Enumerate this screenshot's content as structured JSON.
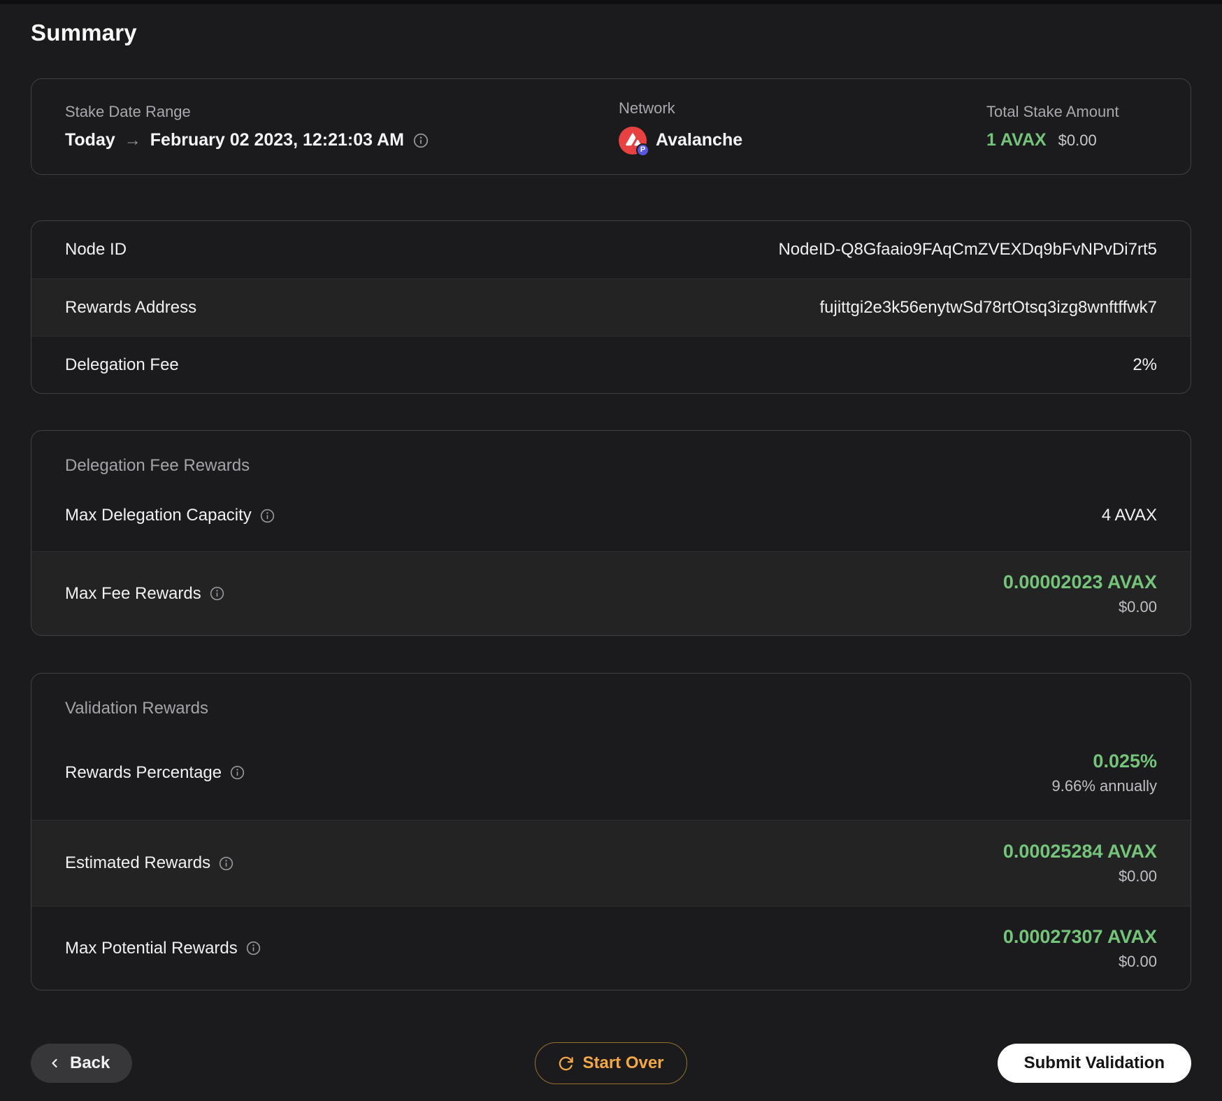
{
  "title": "Summary",
  "overview": {
    "date_range": {
      "label": "Stake Date Range",
      "from": "Today",
      "arrow": "→",
      "to": "February 02 2023, 12:21:03 AM"
    },
    "network": {
      "label": "Network",
      "name": "Avalanche",
      "badge": "P"
    },
    "total_stake": {
      "label": "Total Stake Amount",
      "amount": "1 AVAX",
      "usd": "$0.00"
    }
  },
  "node_details": {
    "rows": [
      {
        "label": "Node ID",
        "value": "NodeID-Q8Gfaaio9FAqCmZVEXDq9bFvNPvDi7rt5"
      },
      {
        "label": "Rewards Address",
        "value": "fujittgi2e3k56enytwSd78rtOtsq3izg8wnftffwk7"
      },
      {
        "label": "Delegation Fee",
        "value": "2%"
      }
    ]
  },
  "delegation_fee_rewards": {
    "title": "Delegation Fee Rewards",
    "max_delegation_capacity": {
      "label": "Max Delegation Capacity",
      "value": "4 AVAX"
    },
    "max_fee_rewards": {
      "label": "Max Fee Rewards",
      "value": "0.00002023 AVAX",
      "usd": "$0.00"
    }
  },
  "validation_rewards": {
    "title": "Validation Rewards",
    "rewards_percentage": {
      "label": "Rewards Percentage",
      "value": "0.025%",
      "sub": "9.66% annually"
    },
    "estimated_rewards": {
      "label": "Estimated Rewards",
      "value": "0.00025284 AVAX",
      "usd": "$0.00"
    },
    "max_potential_rewards": {
      "label": "Max Potential Rewards",
      "value": "0.00027307 AVAX",
      "usd": "$0.00"
    }
  },
  "footer": {
    "back": "Back",
    "start_over": "Start Over",
    "submit": "Submit Validation"
  },
  "colors": {
    "accent_green": "#74C47A",
    "accent_orange": "#F2A844",
    "avalanche_red": "#E84142",
    "badge_purple": "#5558DC",
    "background": "#1B1B1D"
  }
}
